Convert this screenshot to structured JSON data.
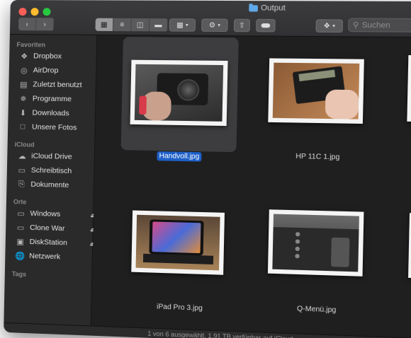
{
  "window": {
    "title": "Output",
    "traffic_lights": {
      "close": "#ff5f57",
      "minimize": "#febc2e",
      "zoom": "#28c840"
    }
  },
  "toolbar": {
    "back_icon": "chevron-left-icon",
    "forward_icon": "chevron-right-icon",
    "view_modes": [
      "icon-view-icon",
      "list-view-icon",
      "column-view-icon",
      "gallery-view-icon"
    ],
    "active_view": "icon-view-icon",
    "group_icon": "group-icon",
    "action_icon": "gear-icon",
    "share_icon": "share-icon",
    "tag_icon": "tag-icon",
    "dropbox_icon": "dropbox-icon",
    "search_placeholder": "Suchen"
  },
  "sidebar": {
    "favorites_title": "Favoriten",
    "favorites": [
      {
        "label": "Dropbox",
        "icon": "dropbox-icon"
      },
      {
        "label": "AirDrop",
        "icon": "airdrop-icon"
      },
      {
        "label": "Zuletzt benutzt",
        "icon": "recents-icon"
      },
      {
        "label": "Programme",
        "icon": "applications-icon"
      },
      {
        "label": "Downloads",
        "icon": "downloads-icon"
      },
      {
        "label": "Unsere Fotos",
        "icon": "folder-icon"
      }
    ],
    "icloud_title": "iCloud",
    "icloud": [
      {
        "label": "iCloud Drive",
        "icon": "cloud-icon"
      },
      {
        "label": "Schreibtisch",
        "icon": "desktop-icon"
      },
      {
        "label": "Dokumente",
        "icon": "document-icon"
      }
    ],
    "locations_title": "Orte",
    "locations": [
      {
        "label": "Windows",
        "icon": "disk-icon",
        "eject": true
      },
      {
        "label": "Clone War",
        "icon": "disk-icon",
        "eject": true
      },
      {
        "label": "DiskStation",
        "icon": "server-icon",
        "eject": true
      },
      {
        "label": "Netzwerk",
        "icon": "network-icon",
        "eject": false
      }
    ],
    "tags_title": "Tags"
  },
  "files": [
    {
      "name": "Handvoll.jpg",
      "selected": true
    },
    {
      "name": "HP 11C 1.jpg",
      "selected": false
    },
    {
      "name": "",
      "selected": false
    },
    {
      "name": "iPad Pro 3.jpg",
      "selected": false
    },
    {
      "name": "Q-Menü.jpg",
      "selected": false
    },
    {
      "name": "",
      "selected": false
    }
  ],
  "status_bar": "1 von 6 ausgewählt, 1.91 TB verfügbar auf iCloud"
}
